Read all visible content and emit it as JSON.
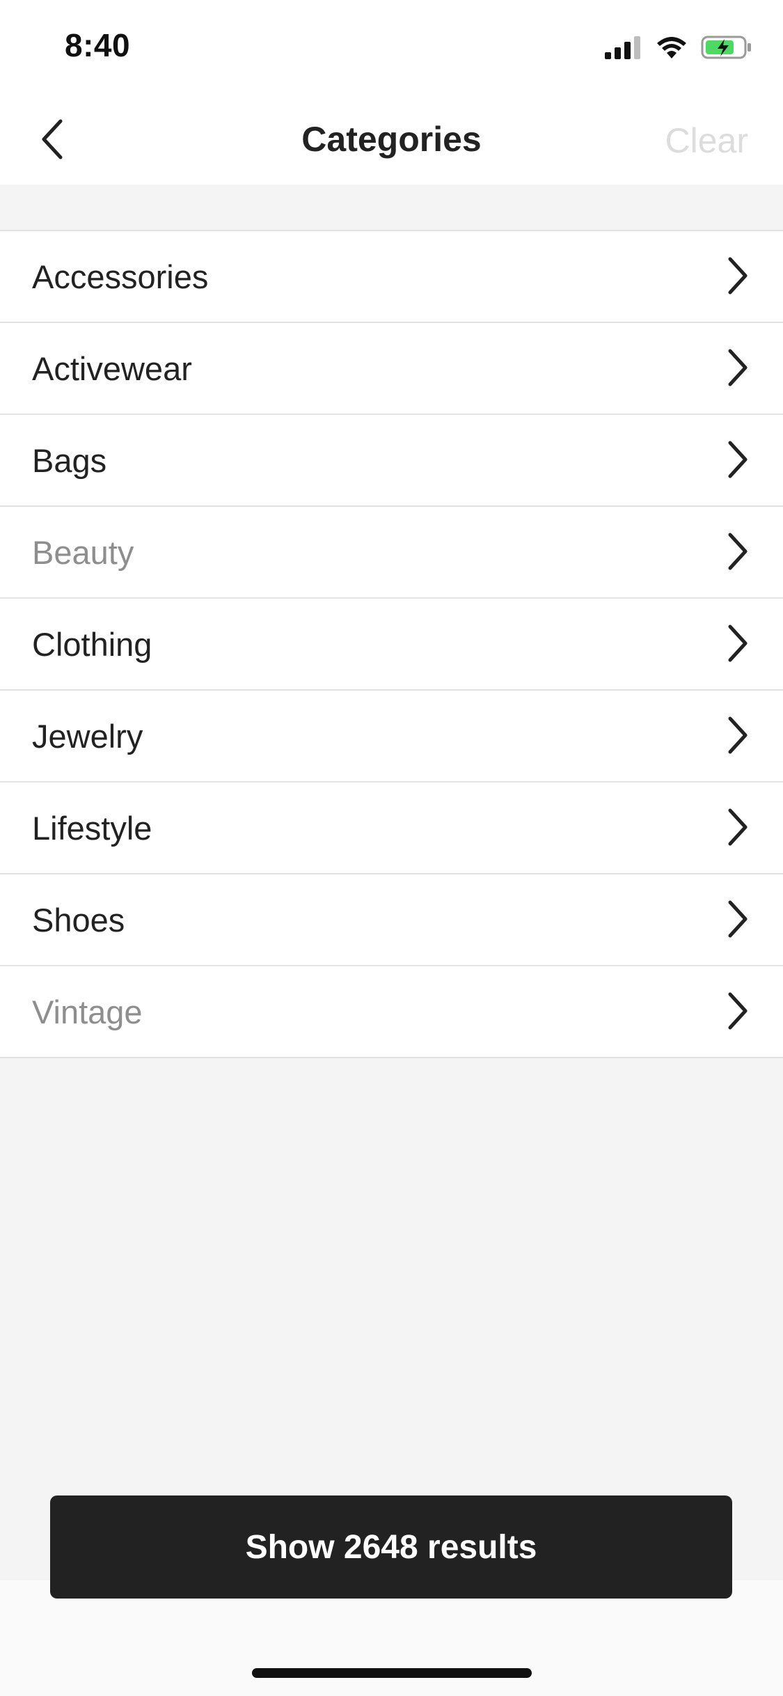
{
  "status": {
    "time": "8:40"
  },
  "nav": {
    "title": "Categories",
    "clear_label": "Clear"
  },
  "categories": [
    {
      "label": "Accessories"
    },
    {
      "label": "Activewear"
    },
    {
      "label": "Bags"
    },
    {
      "label": "Beauty"
    },
    {
      "label": "Clothing"
    },
    {
      "label": "Jewelry"
    },
    {
      "label": "Lifestyle"
    },
    {
      "label": "Shoes"
    },
    {
      "label": "Vintage"
    }
  ],
  "footer": {
    "cta_label": "Show 2648 results"
  },
  "colors": {
    "accent": "#222222",
    "muted": "#8e8e8e",
    "battery": "#4cd964"
  }
}
